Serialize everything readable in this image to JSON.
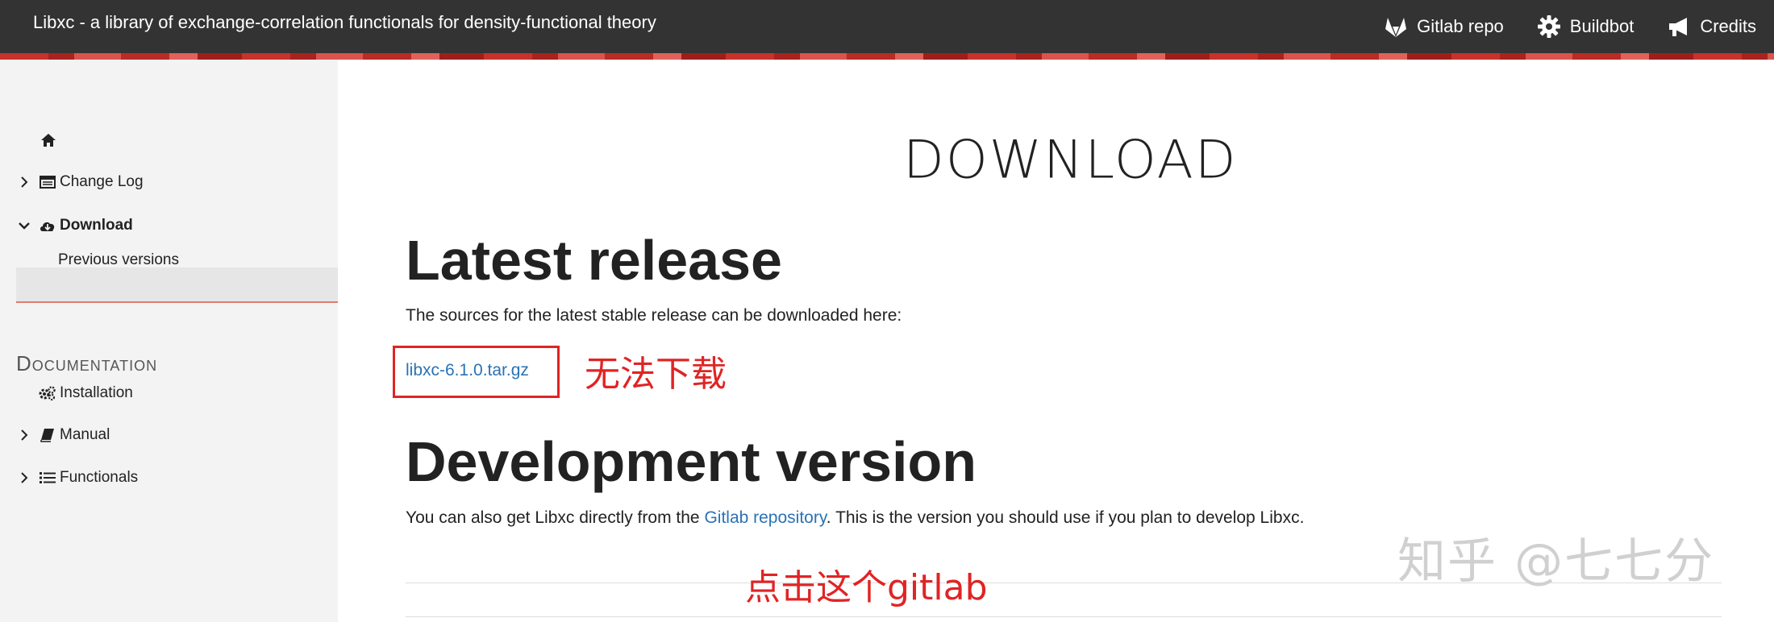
{
  "navbar": {
    "brand": "Libxc - a library of exchange-correlation functionals for density-functional theory",
    "links": [
      {
        "label": "Gitlab repo",
        "icon": "gitlab-icon"
      },
      {
        "label": "Buildbot",
        "icon": "gear-icon"
      },
      {
        "label": "Credits",
        "icon": "megaphone-icon"
      }
    ]
  },
  "sidebar": {
    "home_icon": "home-icon",
    "items": [
      {
        "label": "Change Log",
        "icon": "calendar-icon",
        "expandable": true
      },
      {
        "label": "Download",
        "icon": "cloud-download-icon",
        "expandable": true,
        "active": true
      },
      {
        "label": "Previous versions"
      },
      {
        "label": "Installation",
        "icon": "gears-icon"
      },
      {
        "label": "Manual",
        "icon": "book-icon",
        "expandable": true
      },
      {
        "label": "Functionals",
        "icon": "list-icon",
        "expandable": true
      }
    ],
    "section_title": "Documentation"
  },
  "main": {
    "page_title": "DOWNLOAD",
    "latest_heading": "Latest release",
    "latest_text": "The sources for the latest stable release can be downloaded here:",
    "download_link": "libxc-6.1.0.tar.gz",
    "annotation_1": "无法下载",
    "dev_heading": "Development version",
    "dev_text_before": "You can also get Libxc directly from the ",
    "dev_link": "Gitlab repository",
    "dev_text_after": ". This is the version you should use if you plan to develop Libxc.",
    "annotation_2": "点击这个gitlab",
    "watermark": "知乎 @七七分"
  },
  "colors": {
    "navbar_bg": "#333333",
    "link": "#2a72b5",
    "annotation": "#e02424",
    "sidebar_bg": "#f3f3f3"
  }
}
